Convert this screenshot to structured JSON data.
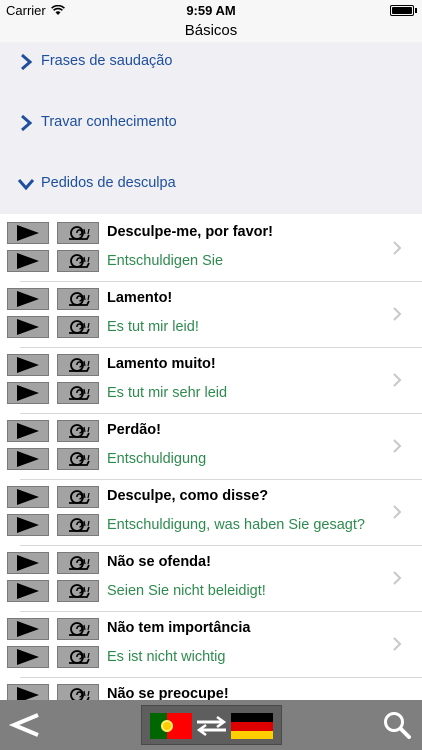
{
  "status_bar": {
    "carrier": "Carrier",
    "time": "9:59 AM"
  },
  "nav": {
    "title": "Básicos"
  },
  "categories": [
    {
      "label": "Frases de saudação",
      "expanded": false
    },
    {
      "label": "Travar conhecimento",
      "expanded": false
    },
    {
      "label": "Pedidos de desculpa",
      "expanded": true
    }
  ],
  "phrases": [
    {
      "pt": "Desculpe-me, por favor!",
      "de": "Entschuldigen Sie"
    },
    {
      "pt": "Lamento!",
      "de": "Es tut mir leid!"
    },
    {
      "pt": "Lamento muito!",
      "de": "Es tut mir sehr leid"
    },
    {
      "pt": "Perdão!",
      "de": "Entschuldigung"
    },
    {
      "pt": "Desculpe, como disse?",
      "de": "Entschuldigung, was haben Sie gesagt?"
    },
    {
      "pt": "Não se ofenda!",
      "de": "Seien Sie nicht beleidigt!"
    },
    {
      "pt": "Não tem importância",
      "de": "Es ist nicht wichtig"
    },
    {
      "pt": "Não se preocupe!",
      "de": ""
    }
  ],
  "colors": {
    "accent": "#1e4f9c",
    "german_text": "#2e8b4e",
    "toolbar": "#7f7f7f"
  },
  "icons": {
    "play": "play-icon",
    "slow": "snail-icon",
    "disclosure": "chevron-right-icon",
    "back": "chevron-left-icon",
    "search": "magnifier-icon",
    "swap": "swap-arrows-icon"
  }
}
